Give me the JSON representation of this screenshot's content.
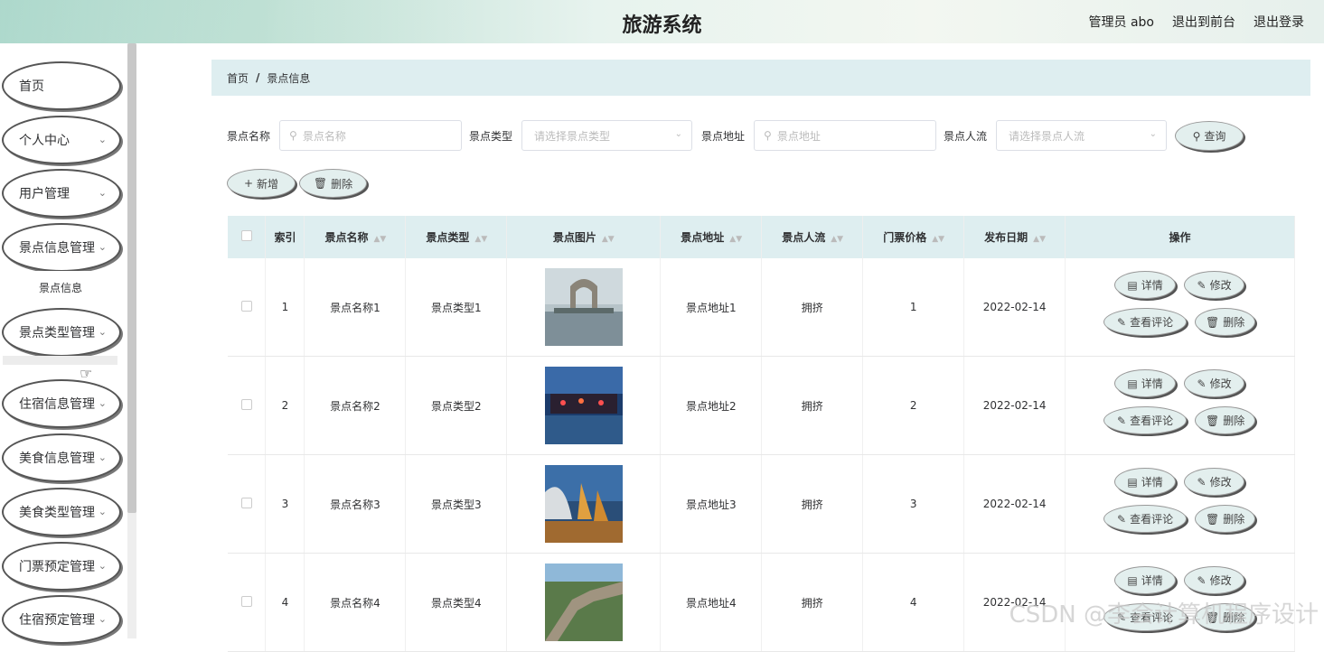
{
  "header": {
    "title": "旅游系统",
    "admin": "管理员 abo",
    "back_front": "退出到前台",
    "logout": "退出登录"
  },
  "sidebar": {
    "items": [
      {
        "label": "首页",
        "chev": false
      },
      {
        "label": "个人中心",
        "chev": true
      },
      {
        "label": "用户管理",
        "chev": true
      },
      {
        "label": "景点信息管理",
        "chev": true
      },
      {
        "label": "景点类型管理",
        "chev": true
      },
      {
        "label": "住宿信息管理",
        "chev": true
      },
      {
        "label": "美食信息管理",
        "chev": true
      },
      {
        "label": "美食类型管理",
        "chev": true
      },
      {
        "label": "门票预定管理",
        "chev": true
      },
      {
        "label": "住宿预定管理",
        "chev": true
      }
    ],
    "submenu": "景点信息"
  },
  "breadcrumb": {
    "home": "首页",
    "sep": "/",
    "current": "景点信息"
  },
  "filters": {
    "name_label": "景点名称",
    "name_placeholder": "景点名称",
    "type_label": "景点类型",
    "type_placeholder": "请选择景点类型",
    "addr_label": "景点地址",
    "addr_placeholder": "景点地址",
    "flow_label": "景点人流",
    "flow_placeholder": "请选择景点人流",
    "query": "查询"
  },
  "actions": {
    "add": "新增",
    "delete": "删除"
  },
  "table": {
    "headers": [
      "索引",
      "景点名称",
      "景点类型",
      "景点图片",
      "景点地址",
      "景点人流",
      "门票价格",
      "发布日期",
      "操作"
    ],
    "rows": [
      {
        "idx": "1",
        "name": "景点名称1",
        "type": "景点类型1",
        "addr": "景点地址1",
        "flow": "拥挤",
        "price": "1",
        "date": "2022-02-14"
      },
      {
        "idx": "2",
        "name": "景点名称2",
        "type": "景点类型2",
        "addr": "景点地址2",
        "flow": "拥挤",
        "price": "2",
        "date": "2022-02-14"
      },
      {
        "idx": "3",
        "name": "景点名称3",
        "type": "景点类型3",
        "addr": "景点地址3",
        "flow": "拥挤",
        "price": "3",
        "date": "2022-02-14"
      },
      {
        "idx": "4",
        "name": "景点名称4",
        "type": "景点类型4",
        "addr": "景点地址4",
        "flow": "拥挤",
        "price": "4",
        "date": "2022-02-14"
      }
    ],
    "ops": {
      "detail": "详情",
      "edit": "修改",
      "review": "查看评论",
      "delete": "删除"
    }
  },
  "watermark": "CSDN @李会计算机程序设计"
}
